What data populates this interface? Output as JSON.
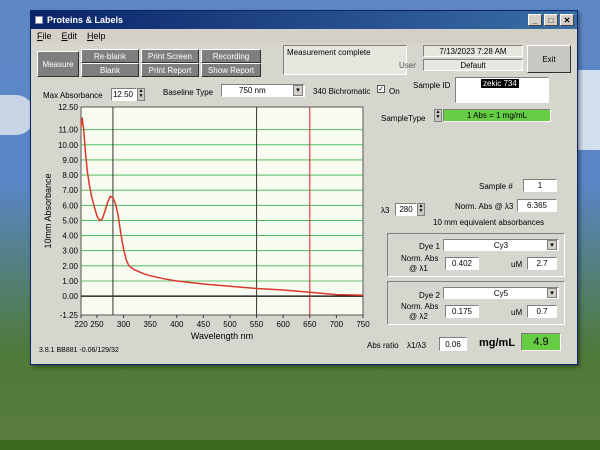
{
  "window": {
    "title": "Proteins & Labels"
  },
  "menu": [
    "File",
    "Edit",
    "Help"
  ],
  "toolbar": {
    "measure": "Measure",
    "reblank": "Re-blank",
    "blank": "Blank",
    "print_screen": "Print Screen",
    "print_report": "Print Report",
    "recording": "Recording",
    "show_report": "Show Report",
    "exit": "Exit"
  },
  "status": {
    "message": "Measurement complete"
  },
  "header": {
    "datetime": "7/13/2023 7:28 AM",
    "user_label": "User",
    "user_value": "Default"
  },
  "controls": {
    "max_abs_label": "Max Absorbance",
    "max_abs_value": "12.50",
    "baseline_label": "Baseline Type",
    "baseline_value": "750 nm",
    "bichromatic_label": "340 Bichromatic",
    "bichromatic_on": "On",
    "sample_id_label": "Sample ID",
    "sample_id_value": "zekic 734",
    "sample_type_label": "SampleType",
    "sample_type_value": "1 Abs = 1 mg/mL"
  },
  "results": {
    "sample_num_label": "Sample #",
    "sample_num_value": "1",
    "lambda3_label": "λ3",
    "lambda3_value": "280",
    "norm_abs_label": "Norm. Abs @ λ3",
    "norm_abs_value": "6.365",
    "equiv_note": "10 mm equivalent absorbances",
    "dye1_label": "Dye 1",
    "dye1_value": "Cy3",
    "dye1_norm_label": "Norm. Abs",
    "dye1_at_label": "@ λ1",
    "dye1_norm_value": "0.402",
    "dye1_um_label": "uM",
    "dye1_um_value": "2.7",
    "dye2_label": "Dye 2",
    "dye2_value": "Cy5",
    "dye2_norm_label": "Norm. Abs",
    "dye2_at_label": "@ λ2",
    "dye2_norm_value": "0.175",
    "dye2_um_label": "uM",
    "dye2_um_value": "0.7",
    "abs_ratio_label": "Abs ratio",
    "abs_ratio_sub": "λ1/λ3",
    "abs_ratio_value": "0.06",
    "mg_label": "mg/mL",
    "mg_value": "4.9"
  },
  "footer": {
    "version": "3.8.1 BB881 -0.06/129/32"
  },
  "colors": {
    "curve": "#d9382c",
    "grid": "#37b24d",
    "plot_bg": "#f8fbf0",
    "result_bg": "#66cc44"
  },
  "chart_data": {
    "type": "line",
    "xlabel": "Wavelength nm",
    "ylabel": "10mm Absorbance",
    "xlim": [
      220,
      750
    ],
    "ylim": [
      -1.25,
      12.5
    ],
    "x_ticks": [
      "220",
      "250",
      "300",
      "350",
      "400",
      "450",
      "500",
      "550",
      "600",
      "650",
      "700",
      "750"
    ],
    "y_ticks": [
      "12.50",
      "11.00",
      "10.00",
      "9.00",
      "8.00",
      "7.00",
      "6.00",
      "5.00",
      "4.00",
      "3.00",
      "2.00",
      "1.00",
      "0.00",
      "-1.25"
    ],
    "x_tick_values": [
      220,
      250,
      300,
      350,
      400,
      450,
      500,
      550,
      600,
      650,
      700,
      750
    ],
    "y_tick_values": [
      12.5,
      11,
      10,
      9,
      8,
      7,
      6,
      5,
      4,
      3,
      2,
      1,
      0,
      -1.25
    ],
    "markers": [
      280,
      550,
      650
    ],
    "series": [
      {
        "x": [
          220,
          222,
          225,
          228,
          232,
          236,
          240,
          245,
          250,
          255,
          260,
          265,
          270,
          275,
          280,
          285,
          290,
          295,
          300,
          305,
          310,
          320,
          330,
          340,
          350,
          375,
          400,
          450,
          500,
          550,
          600,
          650,
          700,
          750
        ],
        "values": [
          11.2,
          11.8,
          11.0,
          9.6,
          8.2,
          7.3,
          6.6,
          5.9,
          5.3,
          5.0,
          5.1,
          5.6,
          6.2,
          6.6,
          6.5,
          6.1,
          5.3,
          4.1,
          3.1,
          2.4,
          2.0,
          1.75,
          1.6,
          1.45,
          1.35,
          1.15,
          1.0,
          0.8,
          0.65,
          0.5,
          0.4,
          0.25,
          0.1,
          0.05
        ]
      }
    ]
  }
}
